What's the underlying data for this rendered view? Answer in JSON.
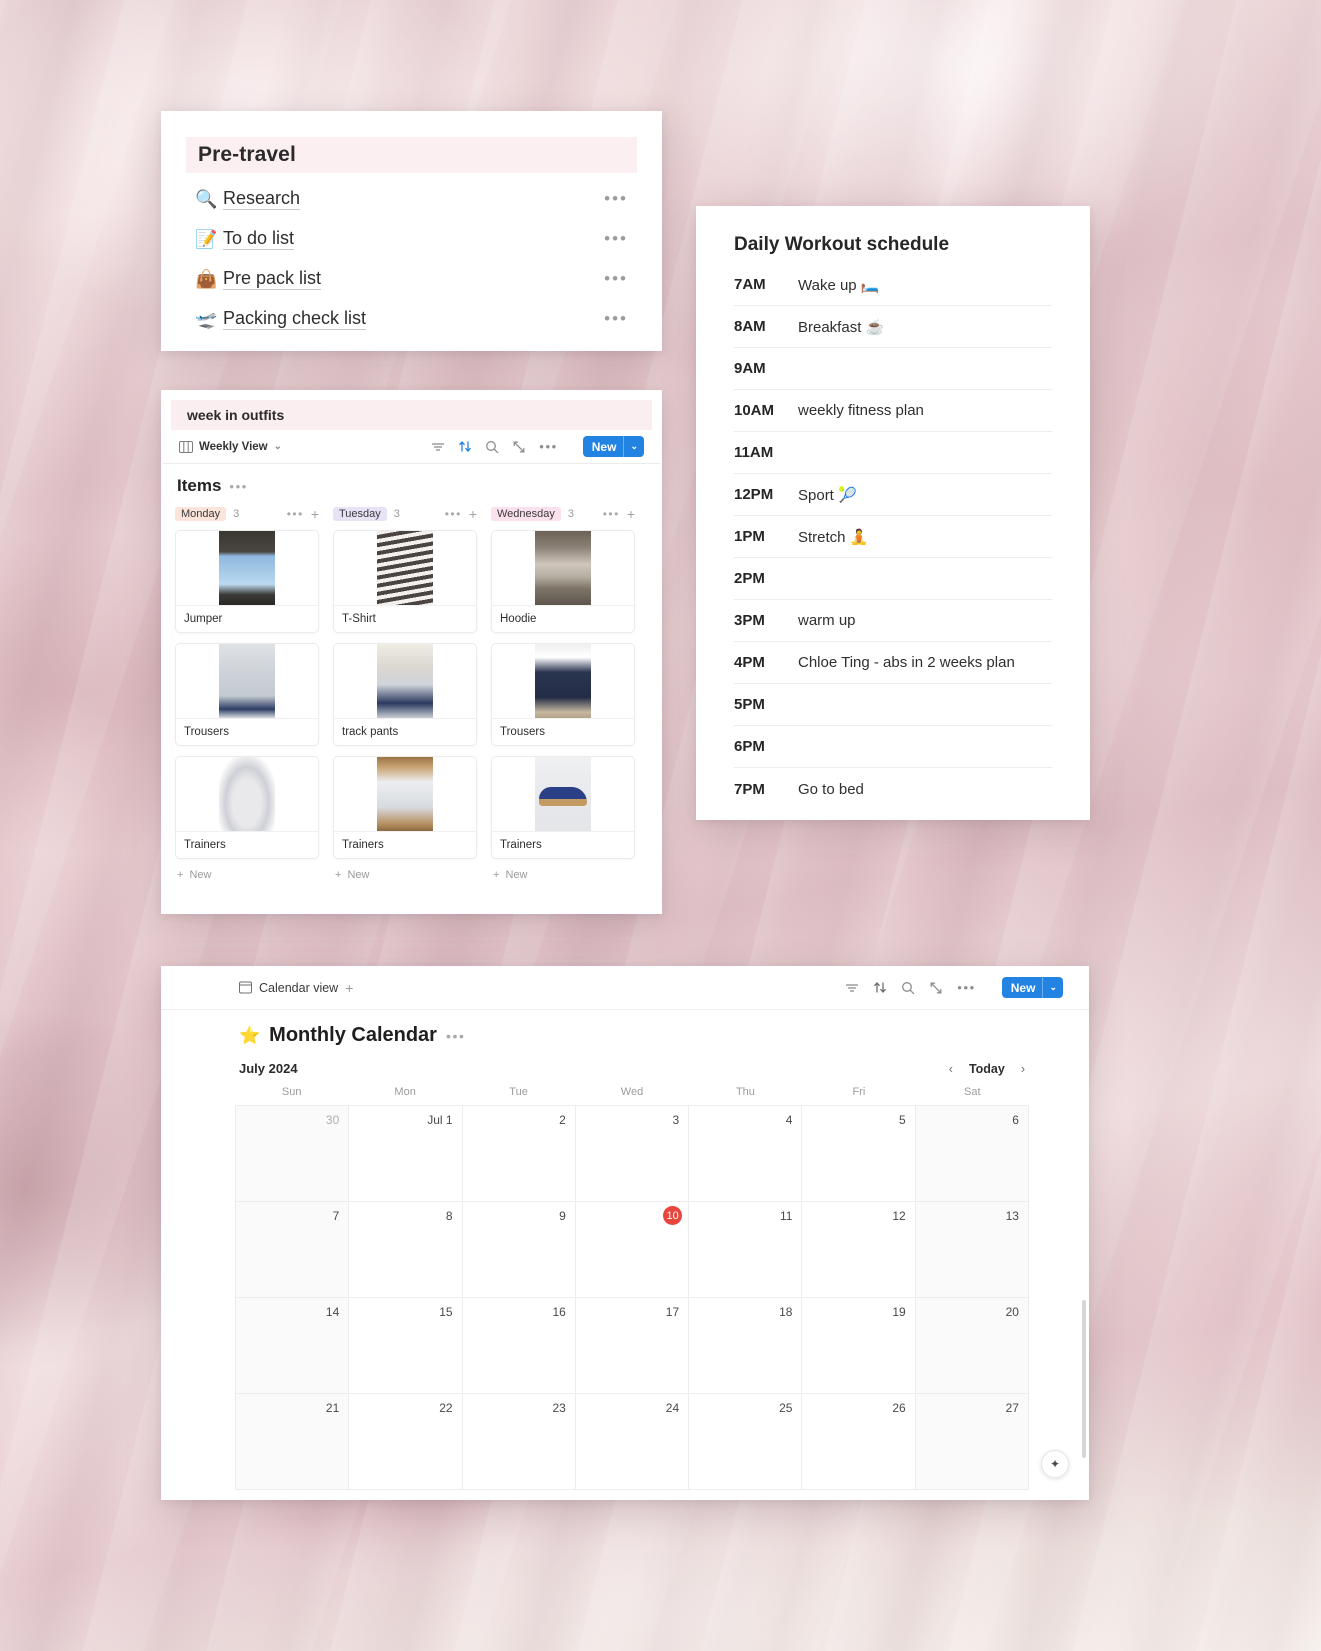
{
  "pre_travel": {
    "title": "Pre-travel",
    "items": [
      {
        "emoji": "🔍",
        "icon_name": "magnifying-glass-emoji",
        "label": "Research",
        "more": "•••"
      },
      {
        "emoji": "📝",
        "icon_name": "memo-emoji",
        "label": "To do list",
        "more": "•••"
      },
      {
        "emoji": "👜",
        "icon_name": "handbag-emoji",
        "label": "Pre pack list",
        "more": "•••"
      },
      {
        "emoji": "🛫",
        "icon_name": "airplane-departure-emoji",
        "label": "Packing check list",
        "more": "•••"
      }
    ]
  },
  "outfits": {
    "title": "week in outfits",
    "view_label": "Weekly View",
    "view_caret": "⌄",
    "items_label": "Items",
    "items_dots": "•••",
    "new_button": {
      "label": "New",
      "caret": "⌄"
    },
    "new_row_label": "New",
    "columns": [
      {
        "day": "Monday",
        "count": "3",
        "chip_bg": "#fbe4da",
        "dots": "•••",
        "plus": "+",
        "cards": [
          {
            "label": "Jumper",
            "thumb": "img-jumper"
          },
          {
            "label": "Trousers",
            "thumb": "img-trousers1"
          },
          {
            "label": "Trainers",
            "thumb": "img-asics"
          }
        ]
      },
      {
        "day": "Tuesday",
        "count": "3",
        "chip_bg": "#e8e2f6",
        "dots": "•••",
        "plus": "+",
        "cards": [
          {
            "label": "T-Shirt",
            "thumb": "img-tshirt"
          },
          {
            "label": "track pants",
            "thumb": "img-track"
          },
          {
            "label": "Trainers",
            "thumb": "img-nb"
          }
        ]
      },
      {
        "day": "Wednesday",
        "count": "3",
        "chip_bg": "#fbe0ee",
        "dots": "•••",
        "plus": "+",
        "cards": [
          {
            "label": "Hoodie",
            "thumb": "img-hoodie"
          },
          {
            "label": "Trousers",
            "thumb": "img-trousers2"
          },
          {
            "label": "Trainers",
            "thumb": "img-samba"
          }
        ]
      }
    ]
  },
  "workout": {
    "title": "Daily Workout schedule",
    "rows": [
      {
        "time": "7AM",
        "task": "Wake up 🛏️"
      },
      {
        "time": "8AM",
        "task": "Breakfast ☕"
      },
      {
        "time": "9AM",
        "task": ""
      },
      {
        "time": "10AM",
        "task": "weekly fitness plan"
      },
      {
        "time": "11AM",
        "task": ""
      },
      {
        "time": "12PM",
        "task": "Sport 🎾"
      },
      {
        "time": "1PM",
        "task": "Stretch 🧘"
      },
      {
        "time": "2PM",
        "task": ""
      },
      {
        "time": "3PM",
        "task": "warm up"
      },
      {
        "time": "4PM",
        "task": "Chloe Ting - abs in 2 weeks plan"
      },
      {
        "time": "5PM",
        "task": ""
      },
      {
        "time": "6PM",
        "task": ""
      },
      {
        "time": "7PM",
        "task": "Go to bed"
      }
    ]
  },
  "calendar": {
    "view_label": "Calendar view",
    "add_view": "+",
    "new_button": {
      "label": "New",
      "caret": "⌄"
    },
    "star": "⭐",
    "heading": "Monthly Calendar",
    "heading_dots": "•••",
    "month_label": "July 2024",
    "nav": {
      "prev": "‹",
      "today": "Today",
      "next": "›"
    },
    "weekdays": [
      "Sun",
      "Mon",
      "Tue",
      "Wed",
      "Thu",
      "Fri",
      "Sat"
    ],
    "today_date": "10",
    "accent_today_color": "#e8453c",
    "weeks": [
      [
        {
          "label": "30",
          "muted": true,
          "today": false
        },
        {
          "label": "Jul 1",
          "muted": false,
          "today": false
        },
        {
          "label": "2",
          "muted": false,
          "today": false
        },
        {
          "label": "3",
          "muted": false,
          "today": false
        },
        {
          "label": "4",
          "muted": false,
          "today": false
        },
        {
          "label": "5",
          "muted": false,
          "today": false
        },
        {
          "label": "6",
          "muted": false,
          "today": false
        }
      ],
      [
        {
          "label": "7",
          "muted": false,
          "today": false
        },
        {
          "label": "8",
          "muted": false,
          "today": false
        },
        {
          "label": "9",
          "muted": false,
          "today": false
        },
        {
          "label": "10",
          "muted": false,
          "today": true
        },
        {
          "label": "11",
          "muted": false,
          "today": false
        },
        {
          "label": "12",
          "muted": false,
          "today": false
        },
        {
          "label": "13",
          "muted": false,
          "today": false
        }
      ],
      [
        {
          "label": "14",
          "muted": false,
          "today": false
        },
        {
          "label": "15",
          "muted": false,
          "today": false
        },
        {
          "label": "16",
          "muted": false,
          "today": false
        },
        {
          "label": "17",
          "muted": false,
          "today": false
        },
        {
          "label": "18",
          "muted": false,
          "today": false
        },
        {
          "label": "19",
          "muted": false,
          "today": false
        },
        {
          "label": "20",
          "muted": false,
          "today": false
        }
      ],
      [
        {
          "label": "21",
          "muted": false,
          "today": false
        },
        {
          "label": "22",
          "muted": false,
          "today": false
        },
        {
          "label": "23",
          "muted": false,
          "today": false
        },
        {
          "label": "24",
          "muted": false,
          "today": false
        },
        {
          "label": "25",
          "muted": false,
          "today": false
        },
        {
          "label": "26",
          "muted": false,
          "today": false
        },
        {
          "label": "27",
          "muted": false,
          "today": false
        }
      ]
    ],
    "sparkle_icon": "✦"
  },
  "theme": {
    "accent_blue": "#2383e2",
    "panel_bg": "#ffffff",
    "title_bar_pink": "#fbeef1"
  }
}
